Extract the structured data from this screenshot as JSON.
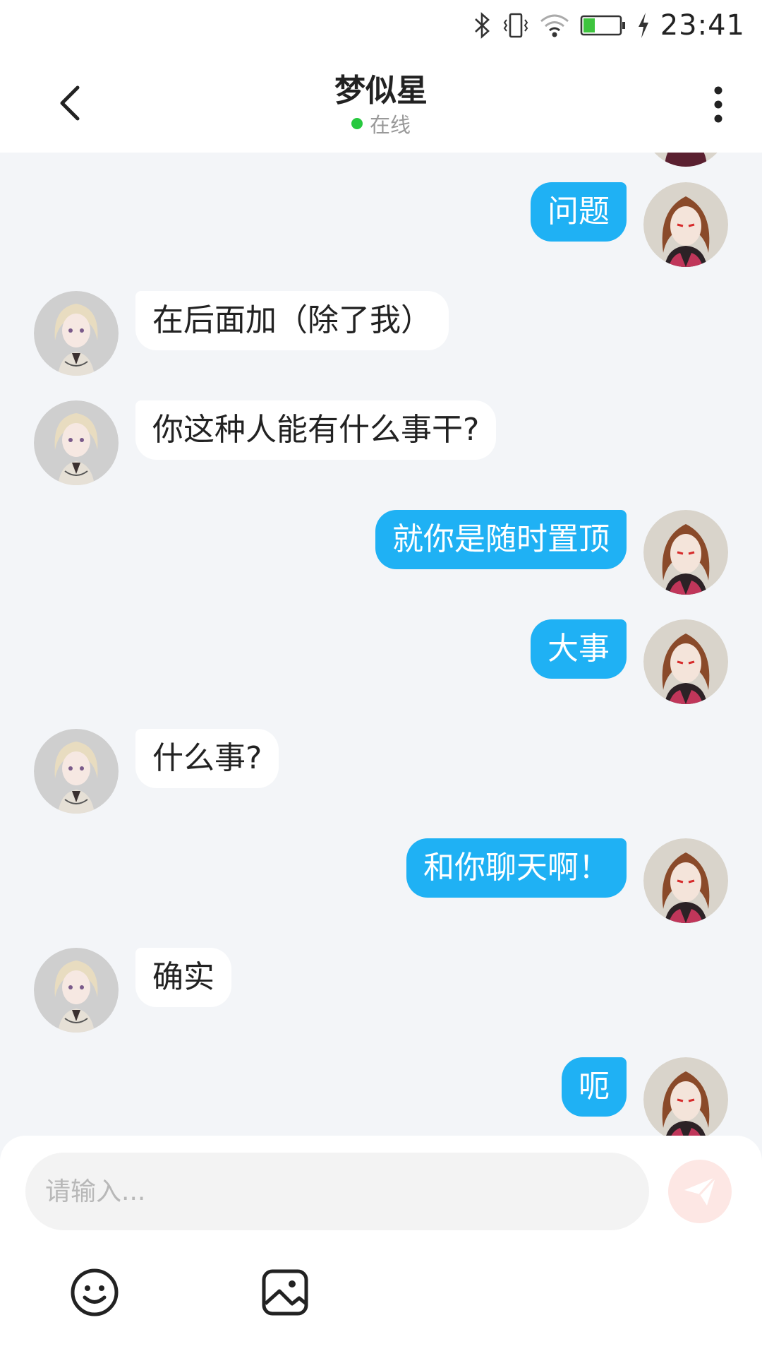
{
  "status_bar": {
    "time": "23:41",
    "icons": [
      "bluetooth-icon",
      "vibrate-icon",
      "wifi-icon",
      "battery-icon",
      "charging-icon"
    ]
  },
  "header": {
    "title": "梦似星",
    "status": "在线",
    "status_color": "#27c93f"
  },
  "messages": [
    {
      "side": "right",
      "text": "问题"
    },
    {
      "side": "left",
      "text": "在后面加（除了我）"
    },
    {
      "side": "left",
      "text": "你这种人能有什么事干?"
    },
    {
      "side": "right",
      "text": "就你是随时置顶"
    },
    {
      "side": "right",
      "text": "大事"
    },
    {
      "side": "left",
      "text": "什么事?"
    },
    {
      "side": "right",
      "text": "和你聊天啊！"
    },
    {
      "side": "left",
      "text": "确实"
    },
    {
      "side": "right",
      "text": "呃"
    }
  ],
  "composer": {
    "placeholder": "请输入...",
    "send_icon": "send-icon",
    "tools": [
      "emoji-icon",
      "image-icon"
    ]
  },
  "colors": {
    "outgoing_bubble": "#1fb1f4",
    "incoming_bubble": "#ffffff",
    "background": "#f3f5f8"
  }
}
